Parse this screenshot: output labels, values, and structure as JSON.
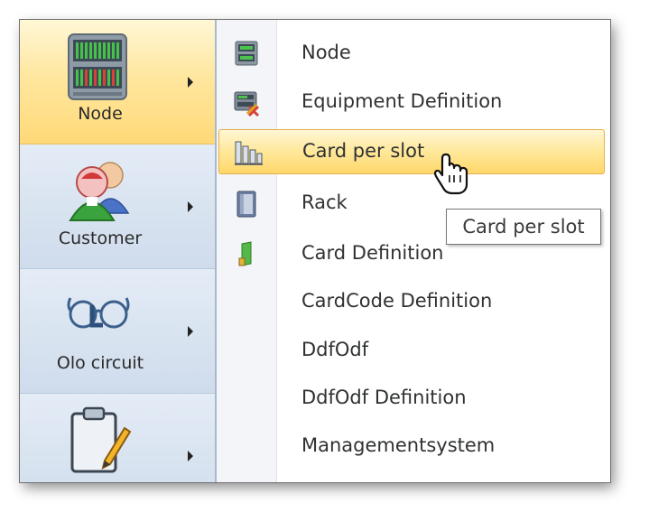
{
  "nav": {
    "items": [
      {
        "label": "Node",
        "icon": "server-icon",
        "active": true
      },
      {
        "label": "Customer",
        "icon": "users-icon",
        "active": false
      },
      {
        "label": "Olo circuit",
        "icon": "glasses-icon",
        "active": false
      },
      {
        "label": "",
        "icon": "clipboard-pencil-icon",
        "active": false
      }
    ]
  },
  "menu": {
    "items": [
      {
        "label": "Node",
        "icon": "node-icon"
      },
      {
        "label": "Equipment Definition",
        "icon": "equipment-definition-icon"
      },
      {
        "label": "Card per slot",
        "icon": "card-per-slot-icon",
        "hovered": true
      },
      {
        "label": "Rack",
        "icon": "rack-icon"
      },
      {
        "label": "Card Definition",
        "icon": "card-definition-icon"
      },
      {
        "label": "CardCode Definition",
        "icon": ""
      },
      {
        "label": "DdfOdf",
        "icon": ""
      },
      {
        "label": "DdfOdf Definition",
        "icon": ""
      },
      {
        "label": "Managementsystem",
        "icon": ""
      }
    ]
  },
  "tooltip": {
    "text": "Card per slot"
  },
  "colors": {
    "hover_fill": "#ffe89a",
    "hover_border": "#e2b04a",
    "nav_bg": "#d9e4f1",
    "active_nav": "#ffe7a0"
  }
}
